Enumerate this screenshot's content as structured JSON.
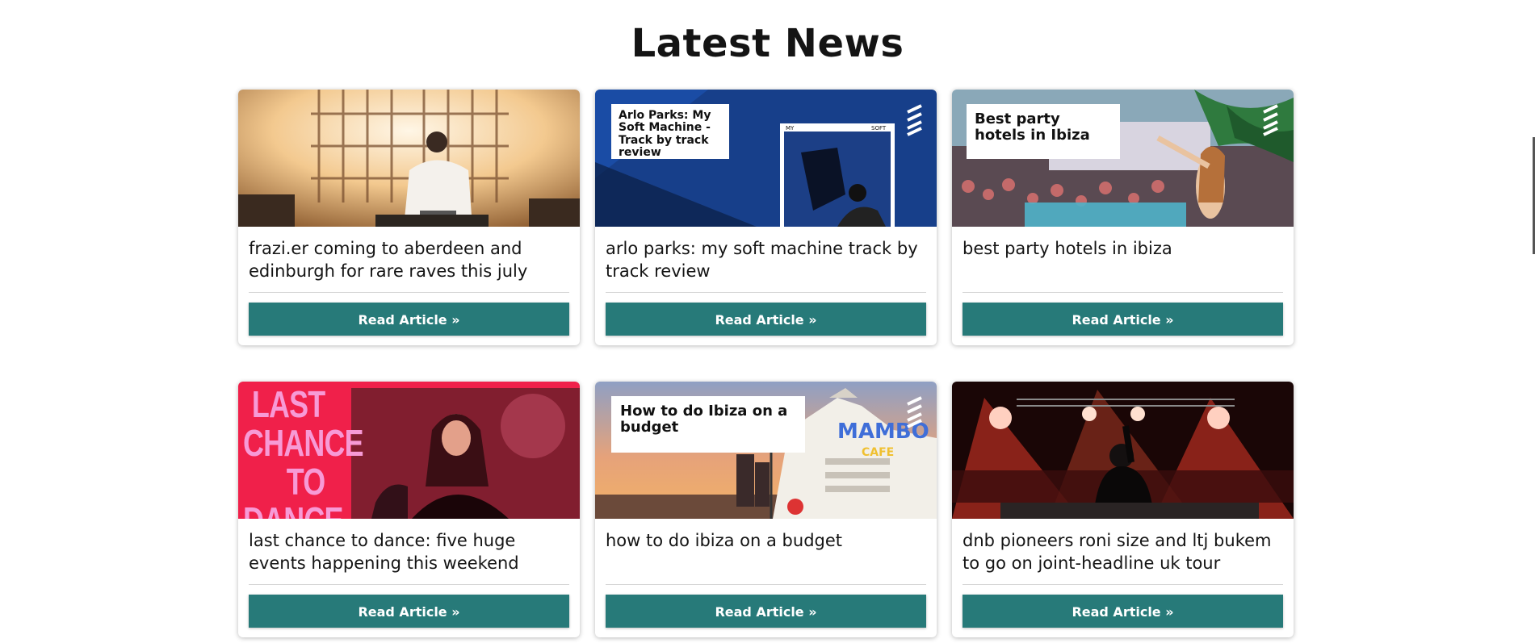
{
  "section": {
    "title": "Latest News"
  },
  "button_label": "Read Article »",
  "colors": {
    "button": "#277a79",
    "overlay_text": "#111111"
  },
  "articles": [
    {
      "title": "frazi.er coming to aberdeen and edinburgh for rare raves this july",
      "image_overlay": ""
    },
    {
      "title": "arlo parks: my soft machine track by track review",
      "image_overlay": "Arlo Parks: My Soft Machine - Track by track review"
    },
    {
      "title": "best party hotels in ibiza",
      "image_overlay": "Best party hotels in Ibiza"
    },
    {
      "title": "last chance to dance: five huge events happening this weekend",
      "image_overlay": "LAST CHANCE TO DANCE"
    },
    {
      "title": "how to do ibiza on a budget",
      "image_overlay": "How to do Ibiza on a budget"
    },
    {
      "title": "dnb pioneers roni size and ltj bukem to go on joint-headline uk tour",
      "image_overlay": ""
    }
  ]
}
